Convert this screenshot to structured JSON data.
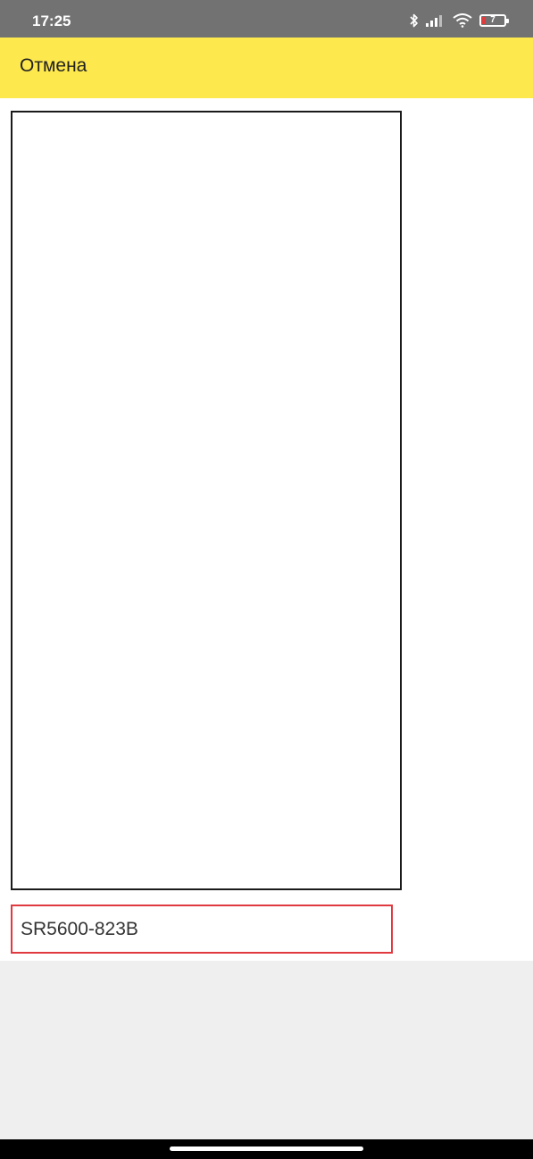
{
  "status_bar": {
    "time": "17:25",
    "battery_level": "7",
    "icons": [
      "bluetooth-icon",
      "signal-icon",
      "wifi-icon",
      "battery-icon"
    ],
    "battery_color": "#e23b3b"
  },
  "toolbar": {
    "cancel_label": "Отмена",
    "background_color": "#fde84e"
  },
  "content": {
    "code_value": "SR5600-823B",
    "field_border_color": "#e0393f"
  }
}
